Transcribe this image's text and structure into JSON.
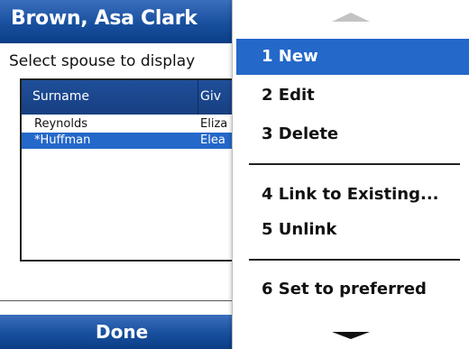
{
  "window": {
    "title": "Brown, Asa Clark"
  },
  "dialog": {
    "prompt": "Select spouse to display"
  },
  "list": {
    "columns": {
      "surname": "Surname",
      "given": "Giv"
    },
    "rows": [
      {
        "surname": "Reynolds",
        "given": "Eliza"
      },
      {
        "surname": "*Huffman",
        "given": "Elea"
      }
    ],
    "selected_row": 1
  },
  "softkeys": {
    "left": "Done"
  },
  "menu": {
    "items": [
      {
        "label": "1 New"
      },
      {
        "label": "2 Edit"
      },
      {
        "label": "3 Delete"
      },
      {
        "label": "4 Link to Existing..."
      },
      {
        "label": "5 Unlink"
      },
      {
        "label": "6 Set to preferred"
      }
    ],
    "selected_index": 0,
    "scroll_up_icon": "scroll-up-arrow",
    "scroll_down_icon": "scroll-down-arrow"
  },
  "colors": {
    "titlebar": "#184f9e",
    "selection": "#2468c9"
  }
}
